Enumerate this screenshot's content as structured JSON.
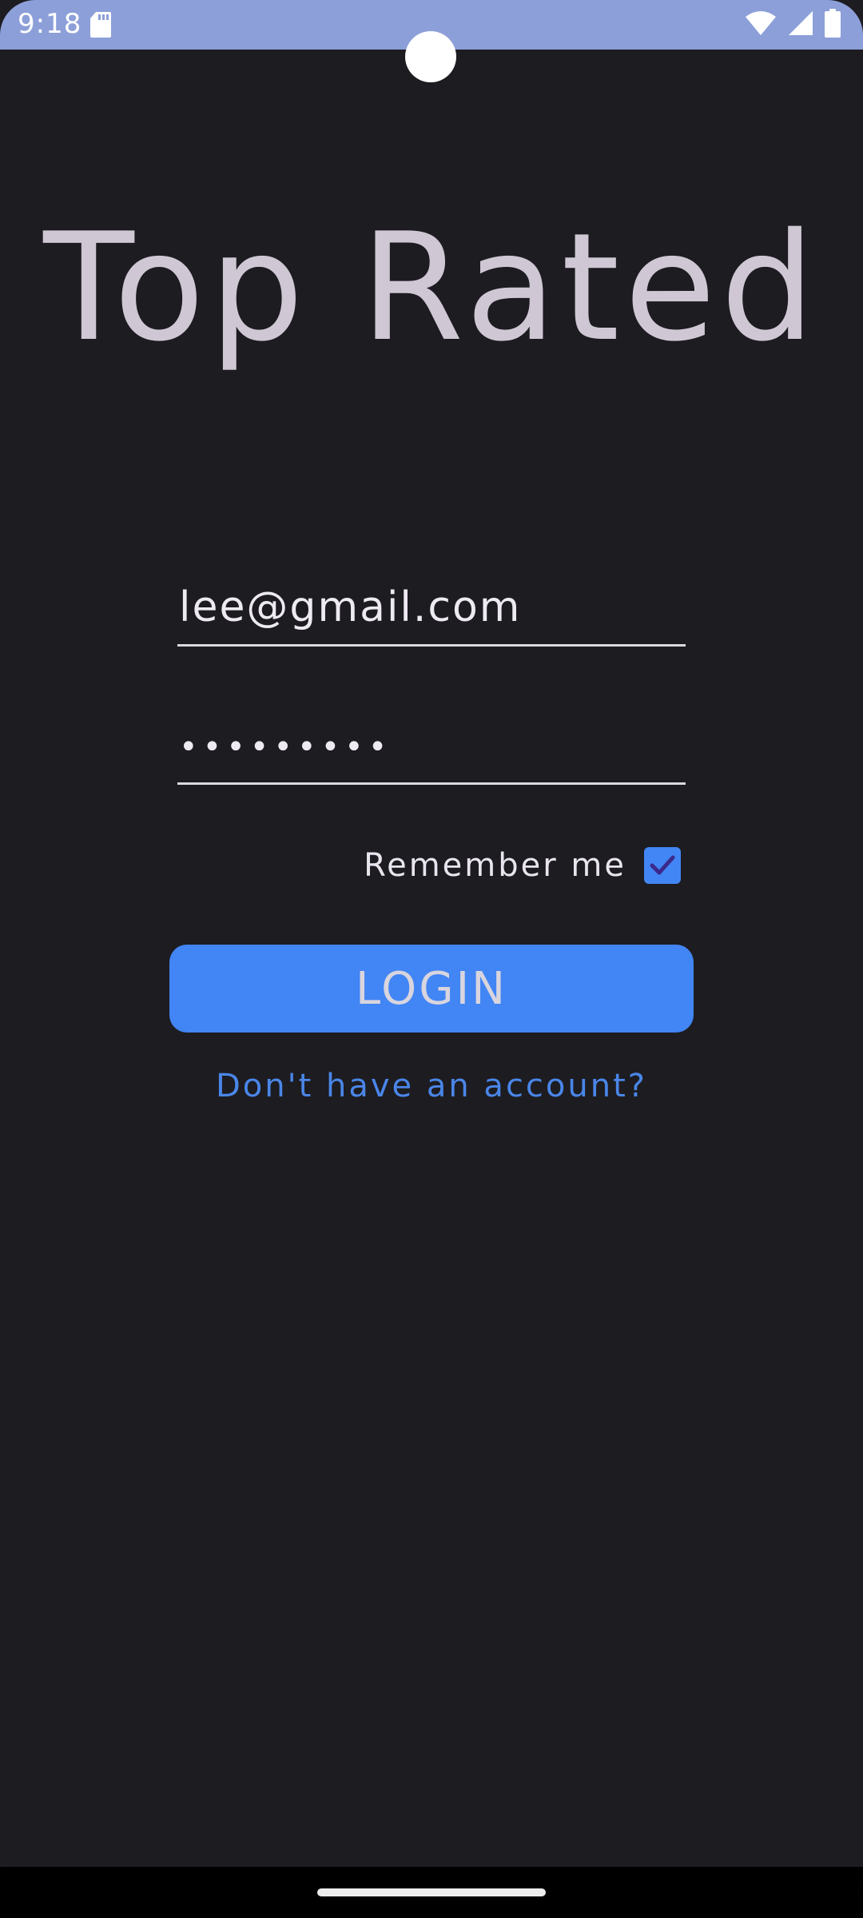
{
  "status_bar": {
    "time": "9:18",
    "icons": [
      "sd-card-icon",
      "wifi-icon",
      "signal-icon",
      "battery-icon"
    ]
  },
  "app": {
    "title": "Top Rated"
  },
  "login_form": {
    "email_value": "lee@gmail.com",
    "password_value": "•••••••••",
    "remember_label": "Remember me",
    "remember_checked": true,
    "login_label": "LOGIN",
    "signup_link": "Don't have an account?"
  },
  "colors": {
    "status_bar": "#8c9fd9",
    "background": "#1d1c21",
    "accent": "#4285f4",
    "title_text": "#cfc8d4",
    "link": "#4a86e8"
  }
}
